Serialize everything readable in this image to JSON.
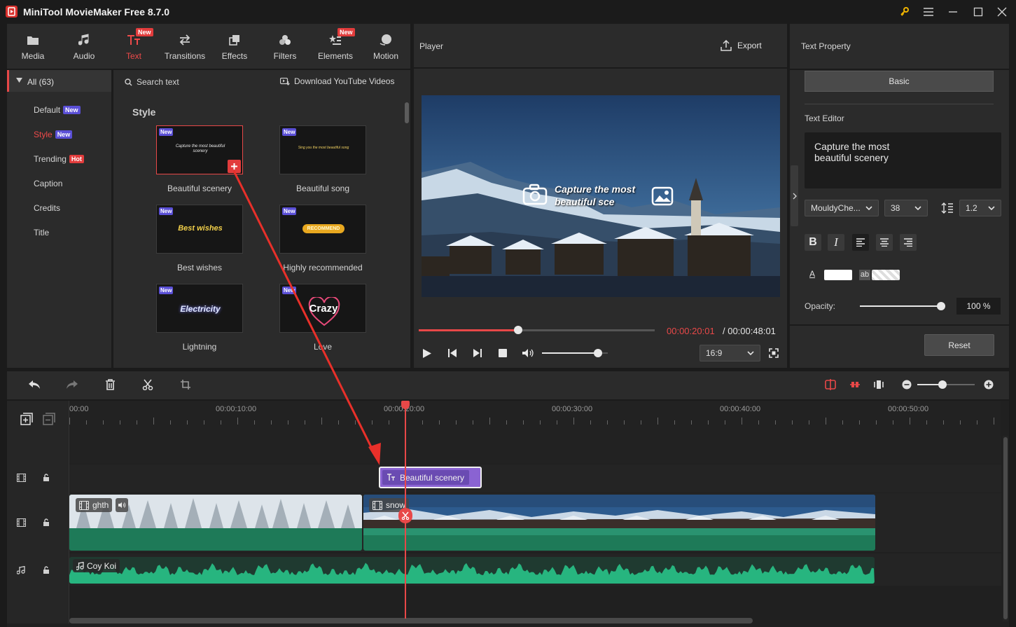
{
  "window": {
    "title": "MiniTool MovieMaker Free 8.7.0",
    "icons": [
      "key-icon",
      "menu-icon",
      "minimize-icon",
      "maximize-icon",
      "close-icon"
    ]
  },
  "toolbar": {
    "items": [
      {
        "label": "Media",
        "icon": "media-icon",
        "badge": ""
      },
      {
        "label": "Audio",
        "icon": "music-note-icon",
        "badge": ""
      },
      {
        "label": "Text",
        "icon": "text-icon",
        "badge": "New"
      },
      {
        "label": "Transitions",
        "icon": "transitions-icon",
        "badge": ""
      },
      {
        "label": "Effects",
        "icon": "effects-icon",
        "badge": ""
      },
      {
        "label": "Filters",
        "icon": "filters-icon",
        "badge": ""
      },
      {
        "label": "Elements",
        "icon": "elements-icon",
        "badge": "New"
      },
      {
        "label": "Motion",
        "icon": "motion-icon",
        "badge": ""
      }
    ],
    "active": "Text"
  },
  "categories": {
    "all_label": "All (63)",
    "items": [
      {
        "label": "Default",
        "tag": "New"
      },
      {
        "label": "Style",
        "tag": "New"
      },
      {
        "label": "Trending",
        "tag": "Hot"
      },
      {
        "label": "Caption",
        "tag": ""
      },
      {
        "label": "Credits",
        "tag": ""
      },
      {
        "label": "Title",
        "tag": ""
      }
    ],
    "selected": "Style"
  },
  "library": {
    "search_placeholder": "Search text",
    "download_label": "Download YouTube Videos",
    "section_title": "Style",
    "new_tag": "New",
    "items": [
      {
        "label": "Beautiful scenery",
        "preview": "Capture the most beautiful scenery"
      },
      {
        "label": "Beautiful song",
        "preview": "Sing you the most beautiful song"
      },
      {
        "label": "Best wishes",
        "preview": "Best wishes"
      },
      {
        "label": "Highly recommended",
        "preview": "RECOMMEND"
      },
      {
        "label": "Lightning",
        "preview": "Electricity"
      },
      {
        "label": "Love",
        "preview": "Crazy"
      }
    ]
  },
  "player": {
    "title": "Player",
    "export_label": "Export",
    "overlay_text_line1": "Capture the most",
    "overlay_text_line2": "beautiful sce",
    "current_time": "00:00:20:01",
    "total_time": "/ 00:00:48:01",
    "progress": 0.42,
    "volume": 0.85,
    "aspect_ratio": "16:9",
    "accent_color": "#e84848"
  },
  "text_property": {
    "title": "Text Property",
    "tab_label": "Basic",
    "editor_label": "Text Editor",
    "editor_text_line1": "Capture the most",
    "editor_text_line2": "beautiful scenery",
    "font": "MouldyChe...",
    "size": "38",
    "line_spacing": "1.2",
    "opacity_label": "Opacity:",
    "opacity_value": "100 %",
    "opacity": 1.0,
    "reset_label": "Reset",
    "text_color": "#ffffff",
    "bg_label": "ab",
    "color_label": "A"
  },
  "timeline": {
    "ruler_labels": [
      "00:00",
      "00:00:10:00",
      "00:00:20:00",
      "00:00:30:00",
      "00:00:40:00",
      "00:00:50:00"
    ],
    "text_clip_label": "Beautiful scenery",
    "video_clip1_label": "ghth",
    "video_clip2_label": "snow",
    "audio_clip_label": "Coy Koi",
    "text_clip_color": "#8a63d2",
    "video_bar_color": "#1e7a58",
    "audio_color": "#27b57f"
  }
}
